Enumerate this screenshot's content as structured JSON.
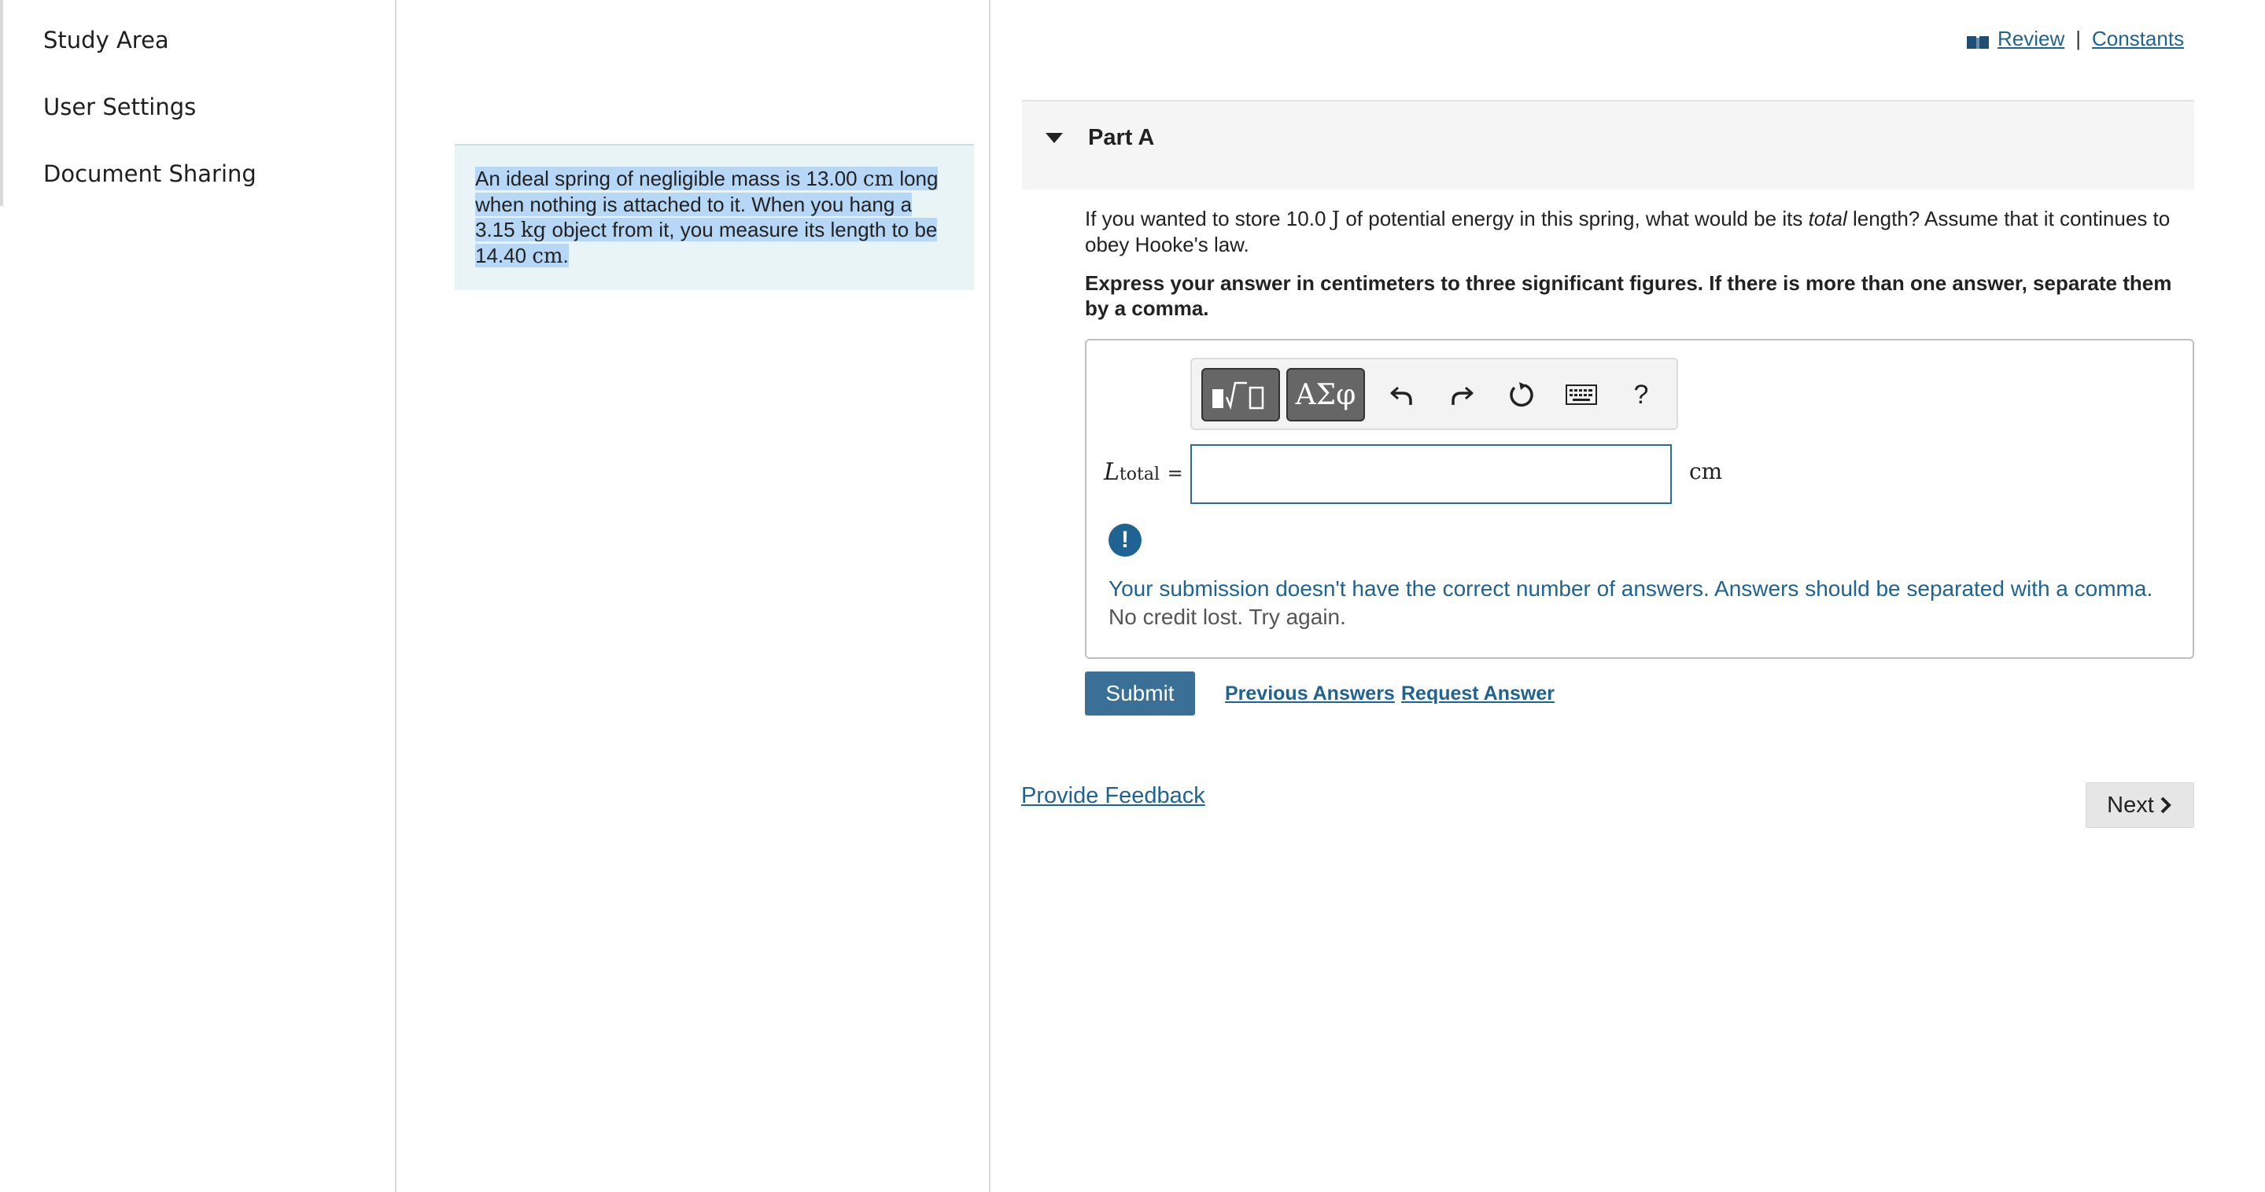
{
  "nav": {
    "items": [
      {
        "label": "Study Area"
      },
      {
        "label": "User Settings"
      },
      {
        "label": "Document Sharing"
      }
    ]
  },
  "problem": {
    "text_1": "An ideal spring of negligible mass is 13.00",
    "unit_cm_1": "cm",
    "text_2": "long when nothing is attached to it. When you hang a 3.15",
    "unit_kg": "kg",
    "text_3": "object from it, you measure its length to be 14.40",
    "unit_cm_2": "cm",
    "text_4": "."
  },
  "header_links": {
    "review": "Review",
    "separator": "|",
    "constants": "Constants"
  },
  "part": {
    "title": "Part A",
    "question_1": "If you wanted to store 10.0",
    "question_unit": "J",
    "question_2": "of potential energy in this spring, what would be its",
    "question_em": "total",
    "question_3": "length? Assume that it continues to obey Hooke's law.",
    "instructions": "Express your answer in centimeters to three significant figures. If there is more than one answer, separate them by a comma."
  },
  "toolbar": {
    "greek_label": "ΑΣφ",
    "help_label": "?"
  },
  "answer": {
    "variable": "L",
    "subscript": "total",
    "equals": "=",
    "input_value": "",
    "unit": "cm"
  },
  "feedback": {
    "alert_symbol": "!",
    "message": "Your submission doesn't have the correct number of answers. Answers should be separated with a comma.",
    "sub_message": "No credit lost. Try again."
  },
  "actions": {
    "submit": "Submit",
    "previous_answers": "Previous Answers",
    "request_answer": "Request Answer",
    "provide_feedback": "Provide Feedback",
    "next": "Next"
  },
  "colors": {
    "link": "#1f6392",
    "submit_bg": "#3a7096",
    "problem_bg": "#e8f4f5",
    "selection": "#b7d7f6"
  }
}
